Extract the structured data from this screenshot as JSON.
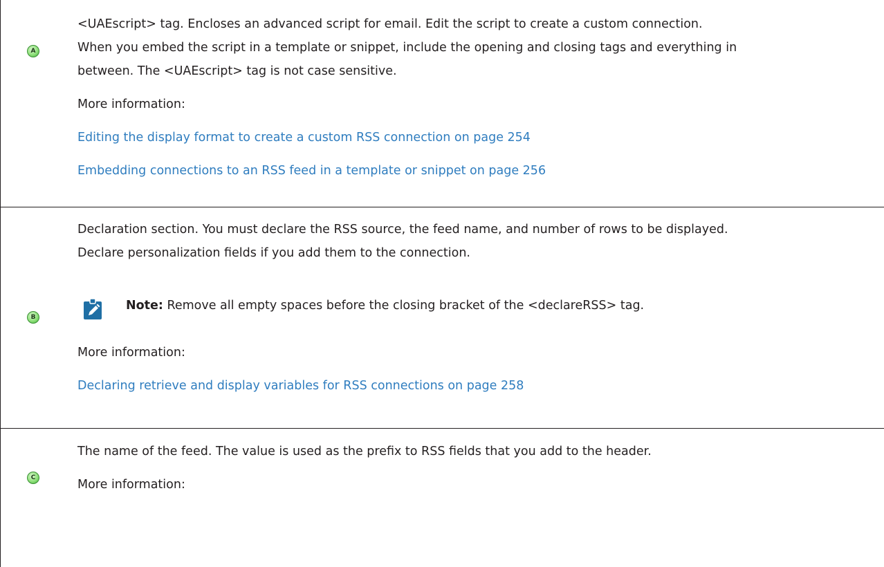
{
  "rows": [
    {
      "marker": "A",
      "text_line1": "<UAEscript> tag. Encloses an advanced script for email. Edit the script to create a custom connection.",
      "text_line2": "When you embed the script in a template or snippet, include the opening and closing tags and everything in",
      "text_line3": "between. The <UAEscript> tag is not case sensitive.",
      "more_info": "More information:",
      "links": [
        "Editing the display format to create a custom RSS connection on page 254",
        "Embedding connections to an RSS feed in a template or snippet on page 256"
      ]
    },
    {
      "marker": "B",
      "text_line1": "Declaration section. You must declare the RSS source, the feed name, and number of rows to be displayed.",
      "text_line2": "Declare personalization fields if you add them to the connection.",
      "note_label": "Note:",
      "note_text": " Remove all empty spaces before the closing bracket of the <declareRSS> tag.",
      "more_info": "More information:",
      "links": [
        "Declaring retrieve and display variables for RSS connections on page 258"
      ]
    },
    {
      "marker": "C",
      "text_line1": "The name of the feed. The value is used as the prefix to RSS fields that you add to the header.",
      "more_info": "More information:"
    }
  ],
  "colors": {
    "link": "#2f7dbf",
    "note_icon": "#1f6fa5",
    "marker_green": "#8fe07a"
  },
  "icons": {
    "note": "pencil-note-icon",
    "marker": "circled-letter-icon"
  }
}
